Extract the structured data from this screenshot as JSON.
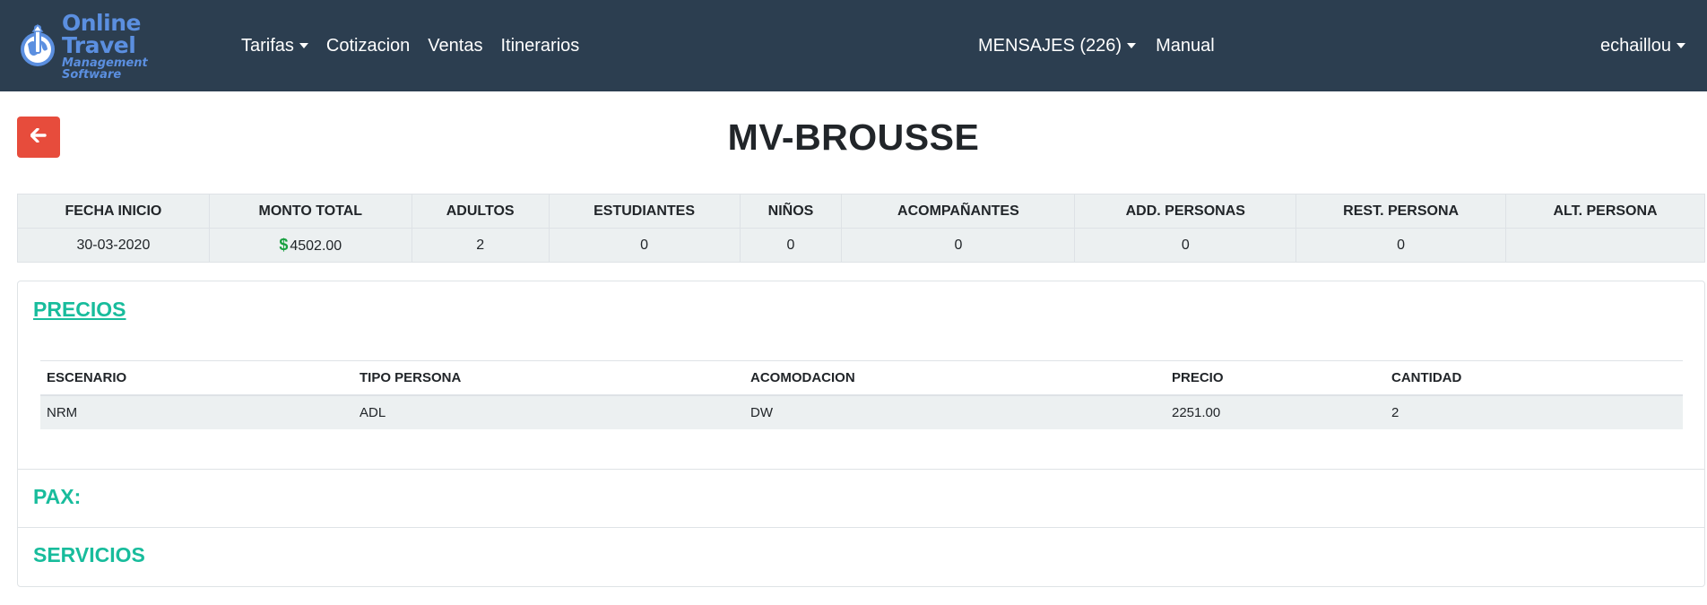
{
  "nav": {
    "brand": {
      "line1": "Online Travel",
      "line2": "Management Software"
    },
    "left_items": [
      {
        "label": "Tarifas",
        "dropdown": true
      },
      {
        "label": "Cotizacion",
        "dropdown": false
      },
      {
        "label": "Ventas",
        "dropdown": false
      },
      {
        "label": "Itinerarios",
        "dropdown": false
      }
    ],
    "messages": "MENSAJES (226)",
    "manual": "Manual",
    "user": "echaillou"
  },
  "page": {
    "title": "MV-BROUSSE",
    "back_icon": "arrow-left-icon"
  },
  "summary": {
    "headers": [
      "FECHA INICIO",
      "MONTO TOTAL",
      "ADULTOS",
      "ESTUDIANTES",
      "NIÑOS",
      "ACOMPAÑANTES",
      "ADD. PERSONAS",
      "REST. PERSONA",
      "ALT. PERSONA"
    ],
    "values": {
      "fecha_inicio": "30-03-2020",
      "monto_currency": "$",
      "monto_total": "4502.00",
      "adultos": "2",
      "estudiantes": "0",
      "ninos": "0",
      "acompanantes": "0",
      "add_personas": "0",
      "rest_persona": "0",
      "alt_persona": ""
    }
  },
  "precios": {
    "title": "PRECIOS",
    "headers": [
      "ESCENARIO",
      "TIPO PERSONA",
      "ACOMODACION",
      "PRECIO",
      "CANTIDAD"
    ],
    "rows": [
      [
        "NRM",
        "ADL",
        "DW",
        "2251.00",
        "2"
      ]
    ]
  },
  "pax": {
    "title": "PAX:"
  },
  "servicios": {
    "title": "SERVICIOS"
  },
  "colors": {
    "navbar": "#2c3e50",
    "accent": "#18bc9c",
    "danger": "#e74c3c",
    "table_bg": "#ecf0f1",
    "money": "#18a040"
  }
}
